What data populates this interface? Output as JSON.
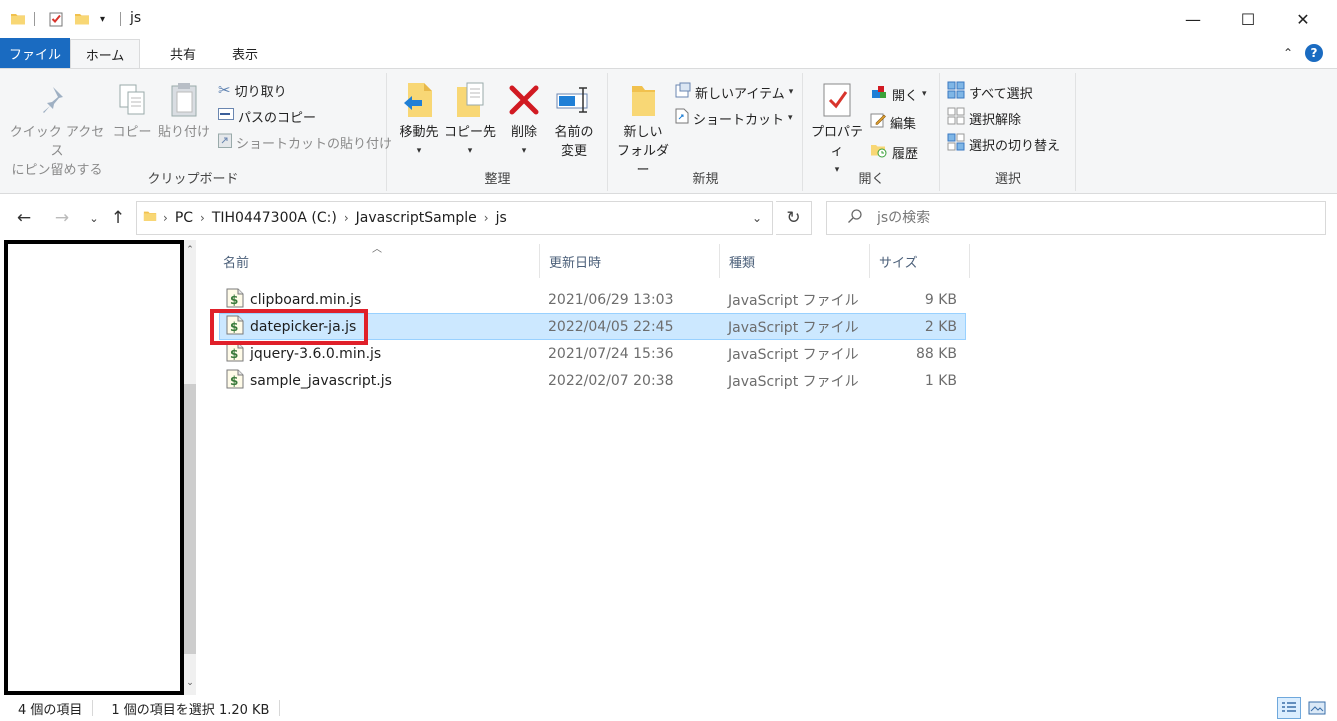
{
  "window": {
    "title": "js",
    "minimize": "—",
    "maximize": "☐",
    "close": "✕"
  },
  "tabs": [
    {
      "label": "ファイル"
    },
    {
      "label": "ホーム"
    },
    {
      "label": "共有"
    },
    {
      "label": "表示"
    }
  ],
  "ribbon": {
    "clipboard": {
      "label": "クリップボード",
      "pin_line1": "クイック アクセス",
      "pin_line2": "にピン留めする",
      "copy": "コピー",
      "paste": "貼り付け",
      "cut": "切り取り",
      "copy_path": "パスのコピー",
      "paste_shortcut": "ショートカットの貼り付け"
    },
    "organize": {
      "label": "整理",
      "move_to": "移動先",
      "copy_to": "コピー先",
      "delete": "削除",
      "rename_line1": "名前の",
      "rename_line2": "変更"
    },
    "new": {
      "label": "新規",
      "new_folder_line1": "新しい",
      "new_folder_line2": "フォルダー",
      "new_item": "新しいアイテム",
      "shortcut": "ショートカット"
    },
    "open": {
      "label": "開く",
      "properties": "プロパティ",
      "open": "開く",
      "edit": "編集",
      "history": "履歴"
    },
    "select": {
      "label": "選択",
      "select_all": "すべて選択",
      "select_none": "選択解除",
      "invert": "選択の切り替え"
    }
  },
  "address": {
    "crumbs": [
      "PC",
      "TIH0447300A (C:)",
      "JavascriptSample",
      "js"
    ],
    "search_placeholder": "jsの検索"
  },
  "columns": {
    "name": "名前",
    "date": "更新日時",
    "type": "種類",
    "size": "サイズ"
  },
  "files": [
    {
      "name": "clipboard.min.js",
      "date": "2021/06/29 13:03",
      "type": "JavaScript ファイル",
      "size": "9 KB"
    },
    {
      "name": "datepicker-ja.js",
      "date": "2022/04/05 22:45",
      "type": "JavaScript ファイル",
      "size": "2 KB"
    },
    {
      "name": "jquery-3.6.0.min.js",
      "date": "2021/07/24 15:36",
      "type": "JavaScript ファイル",
      "size": "88 KB"
    },
    {
      "name": "sample_javascript.js",
      "date": "2022/02/07 20:38",
      "type": "JavaScript ファイル",
      "size": "1 KB"
    }
  ],
  "status": {
    "item_count": "4 個の項目",
    "selection": "1 個の項目を選択  1.20 KB"
  },
  "colors": {
    "accent": "#1a6bc1",
    "selected_row": "#cce8ff",
    "highlight": "#e0202a"
  }
}
